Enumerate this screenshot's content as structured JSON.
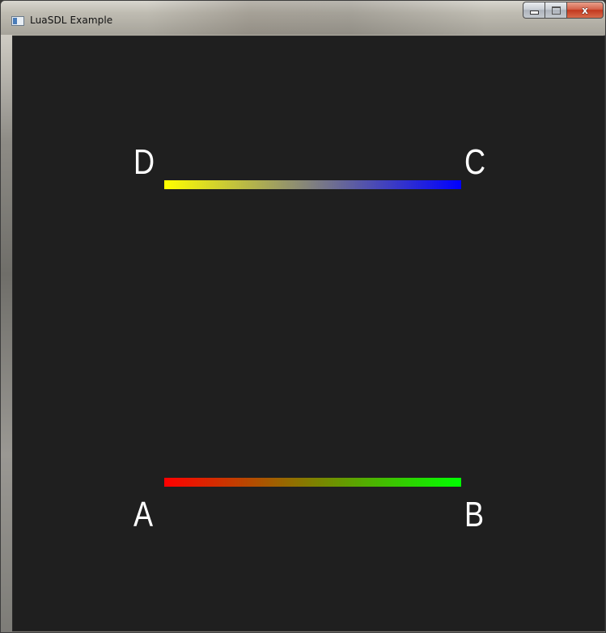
{
  "window": {
    "title": "LuaSDL Example",
    "icon": "app-window-icon",
    "controls": {
      "minimize": "minimize-icon",
      "maximize": "maximize-icon",
      "close": "x"
    }
  },
  "canvas": {
    "background": "#1f1f1f",
    "top_line": {
      "start_label": "D",
      "end_label": "C",
      "start_color": "#ffff00",
      "end_color": "#0000ff"
    },
    "bottom_line": {
      "start_label": "A",
      "end_label": "B",
      "start_color": "#ff0000",
      "end_color": "#00ff00"
    },
    "label_color": "#ffffff"
  }
}
